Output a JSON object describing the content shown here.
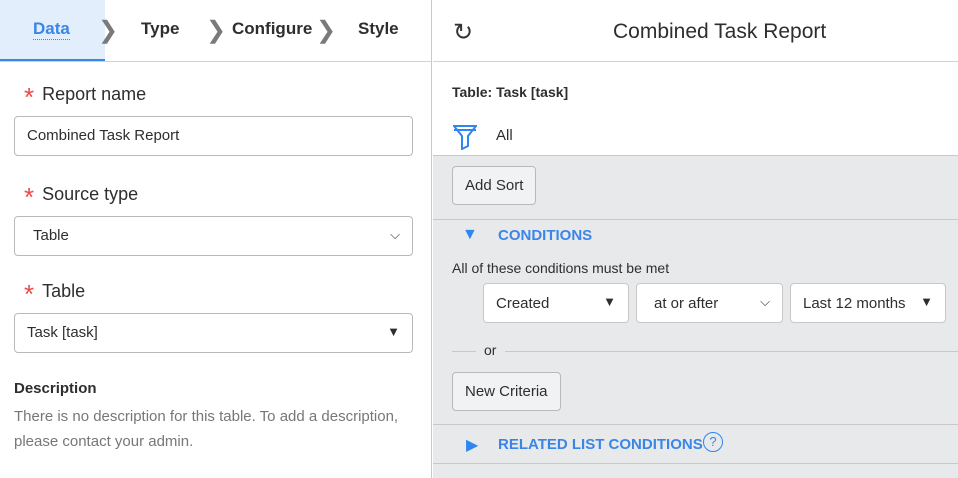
{
  "steps": [
    "Data",
    "Type",
    "Configure",
    "Style"
  ],
  "form": {
    "report_name_label": "Report name",
    "report_name_value": "Combined Task Report",
    "source_type_label": "Source type",
    "source_type_value": "Table",
    "table_label": "Table",
    "table_value": "Task [task]",
    "description_heading": "Description",
    "description_text": "There is no description for this table. To add a description, please contact your admin."
  },
  "preview": {
    "title": "Combined Task Report",
    "table_info": "Table: Task [task]",
    "filter_label": "All",
    "add_sort": "Add Sort",
    "conditions_heading": "CONDITIONS",
    "conditions_note": "All of these conditions must be met",
    "condition": {
      "field": "Created",
      "operator": "at or after",
      "value": "Last 12 months"
    },
    "or_label": "or",
    "new_criteria": "New Criteria",
    "related_heading": "RELATED LIST CONDITIONS",
    "help_icon": "?"
  }
}
